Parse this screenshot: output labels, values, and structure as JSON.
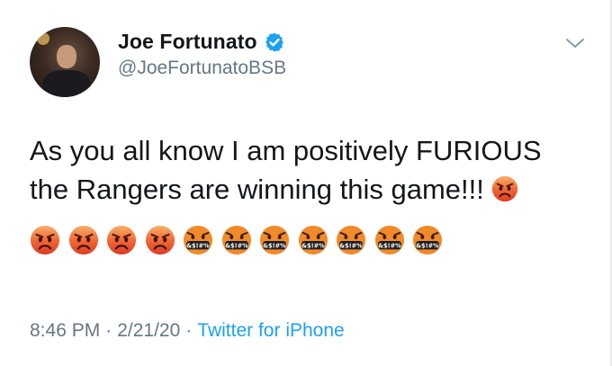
{
  "author": {
    "name": "Joe Fortunato",
    "handle": "@JoeFortunatoBSB",
    "verified": true
  },
  "tweet": {
    "text": "As you all know I am positively FURIOUS the Rangers are winning this game!!!",
    "emoji_sequence": [
      "pouting-face",
      "pouting-face",
      "pouting-face",
      "pouting-face",
      "pouting-face",
      "face-with-symbols-on-mouth",
      "face-with-symbols-on-mouth",
      "face-with-symbols-on-mouth",
      "face-with-symbols-on-mouth",
      "face-with-symbols-on-mouth",
      "face-with-symbols-on-mouth",
      "face-with-symbols-on-mouth"
    ]
  },
  "meta": {
    "time": "8:46 PM",
    "separator": "·",
    "date": "2/21/20",
    "source": "Twitter for iPhone"
  },
  "emoji_grawlix": "&$!#%",
  "colors": {
    "text": "#14171a",
    "secondary": "#657786",
    "link": "#1da1f2",
    "verified": "#1da1f2",
    "pouting_top": "#f7a35c",
    "pouting_bottom": "#e8452c",
    "symbols_face": "#f08a2a"
  }
}
